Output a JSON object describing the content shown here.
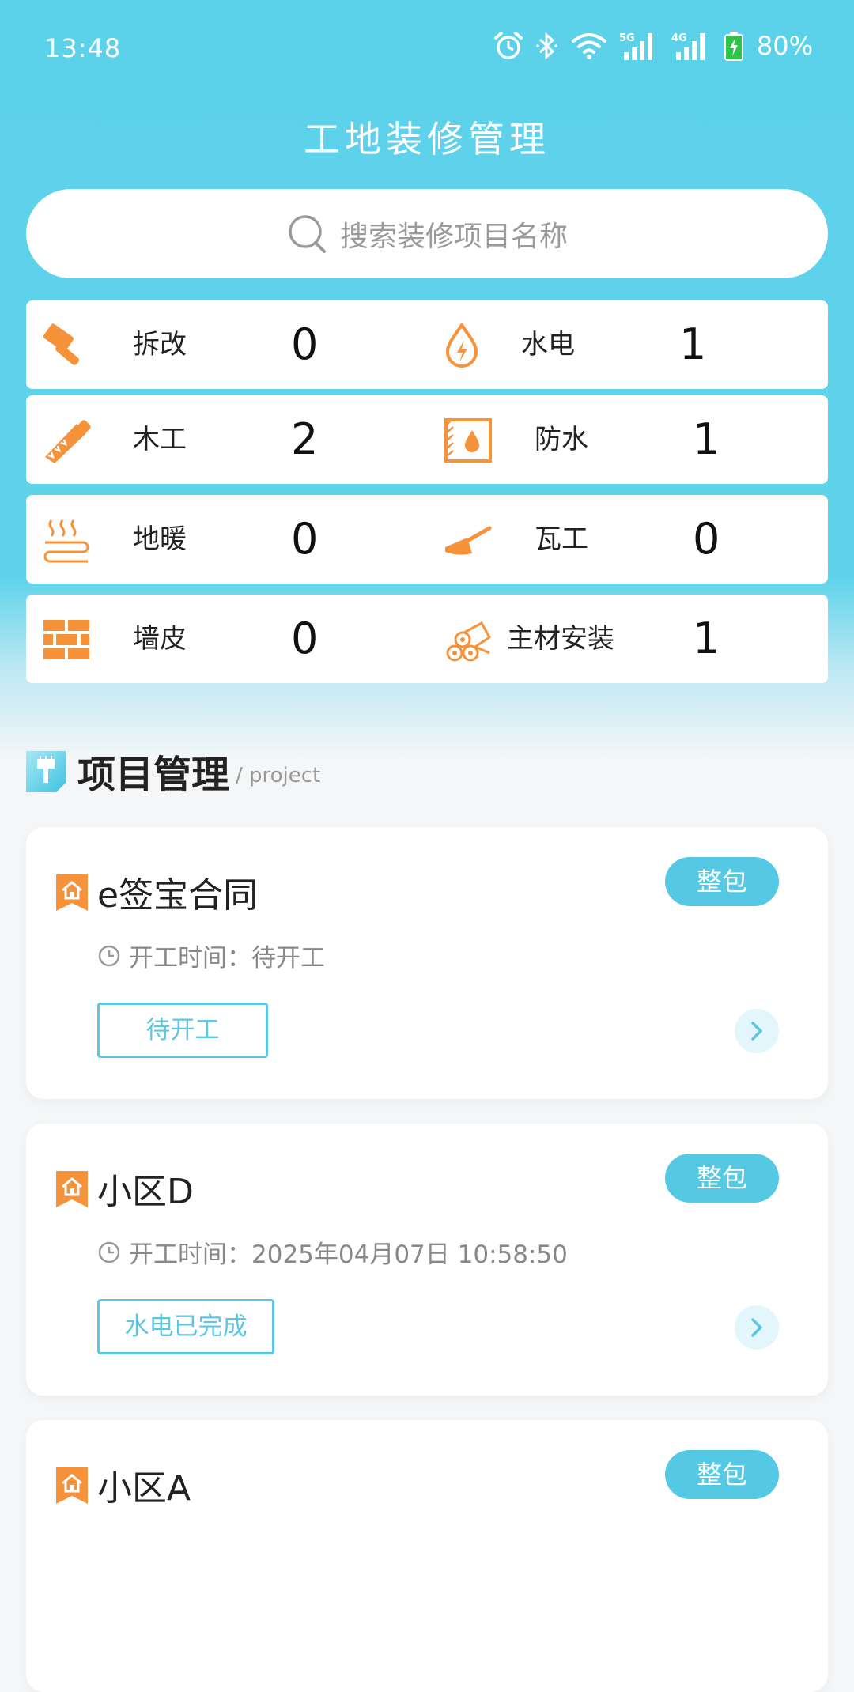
{
  "colors": {
    "primary": "#5cd2ea",
    "accent_orange": "#f5923a",
    "badge": "#55c9e4",
    "status_text": "#5cc7e0"
  },
  "status_bar": {
    "time": "13:48",
    "battery": "80%",
    "icons": [
      "alarm-icon",
      "bluetooth-icon",
      "wifi-icon",
      "signal-5g-icon",
      "signal-4g-icon",
      "battery-charging-icon"
    ]
  },
  "header": {
    "title": "工地装修管理"
  },
  "search": {
    "placeholder": "搜索装修项目名称"
  },
  "categories": [
    {
      "label": "拆改",
      "count": "0",
      "icon": "hammer-icon"
    },
    {
      "label": "水电",
      "count": "1",
      "icon": "water-electric-icon"
    },
    {
      "label": "木工",
      "count": "2",
      "icon": "saw-icon"
    },
    {
      "label": "防水",
      "count": "1",
      "icon": "waterproof-icon"
    },
    {
      "label": "地暖",
      "count": "0",
      "icon": "floor-heating-icon"
    },
    {
      "label": "瓦工",
      "count": "0",
      "icon": "trowel-icon"
    },
    {
      "label": "墙皮",
      "count": "0",
      "icon": "brick-wall-icon"
    },
    {
      "label": "主材安装",
      "count": "1",
      "icon": "logs-icon"
    }
  ],
  "section": {
    "title": "项目管理",
    "subtitle": "/ project"
  },
  "projects": [
    {
      "name": "e签宝合同",
      "badge": "整包",
      "time_label": "开工时间：",
      "time": "待开工",
      "status": "待开工"
    },
    {
      "name": "小区D",
      "badge": "整包",
      "time_label": "开工时间：",
      "time": "2025年04月07日 10:58:50",
      "status": "水电已完成"
    },
    {
      "name": "小区A",
      "badge": "整包"
    }
  ]
}
